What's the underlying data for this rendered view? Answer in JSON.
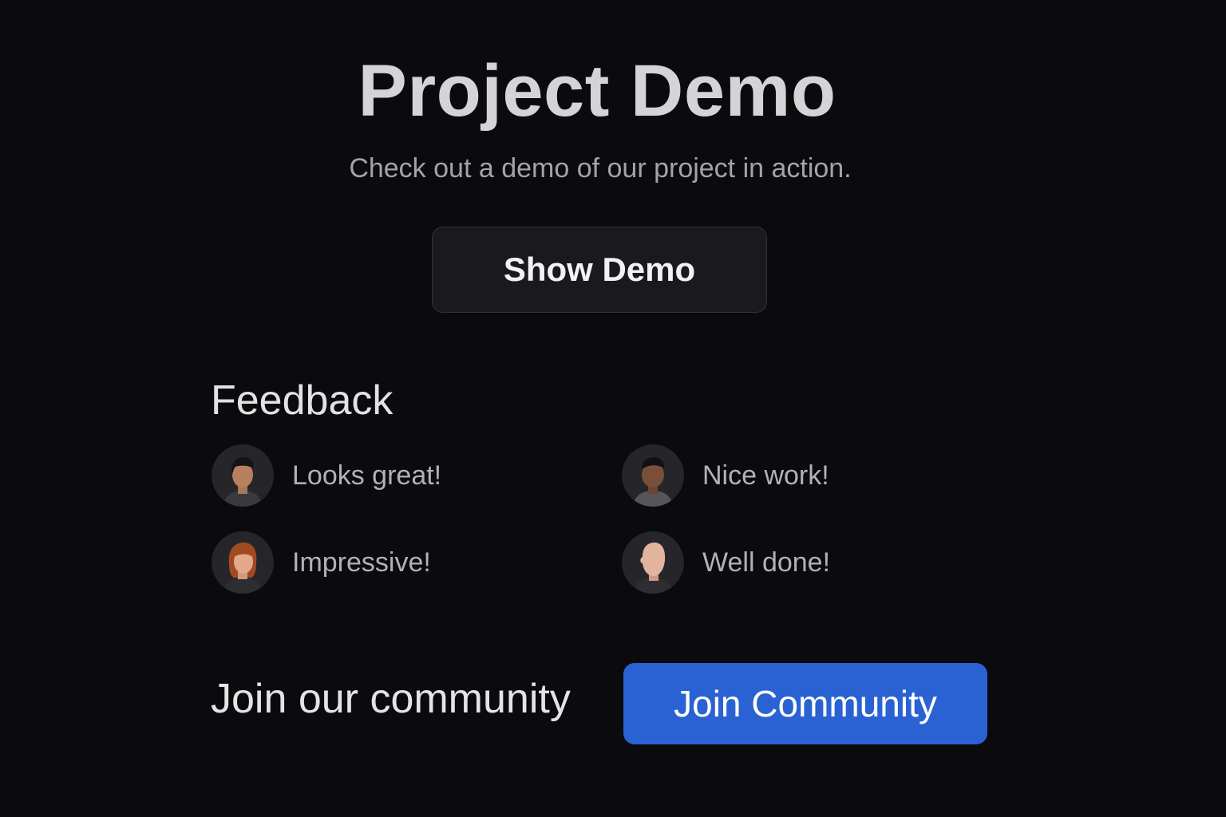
{
  "header": {
    "title": "Project Demo",
    "subtitle": "Check out a demo of our project in action."
  },
  "demo": {
    "button_label": "Show Demo"
  },
  "feedback": {
    "heading": "Feedback",
    "items": [
      {
        "text": "Looks great!",
        "avatar": "avatar-person-dark-hair"
      },
      {
        "text": "Nice work!",
        "avatar": "avatar-person-dark-skin"
      },
      {
        "text": "Impressive!",
        "avatar": "avatar-person-red-hair"
      },
      {
        "text": "Well done!",
        "avatar": "avatar-person-bald"
      }
    ]
  },
  "community": {
    "prompt": "Join our community",
    "button_label": "Join Community"
  },
  "colors": {
    "background": "#0b0b0d",
    "accent": "#2a62d4",
    "button_dark": "#1a1a1d"
  }
}
